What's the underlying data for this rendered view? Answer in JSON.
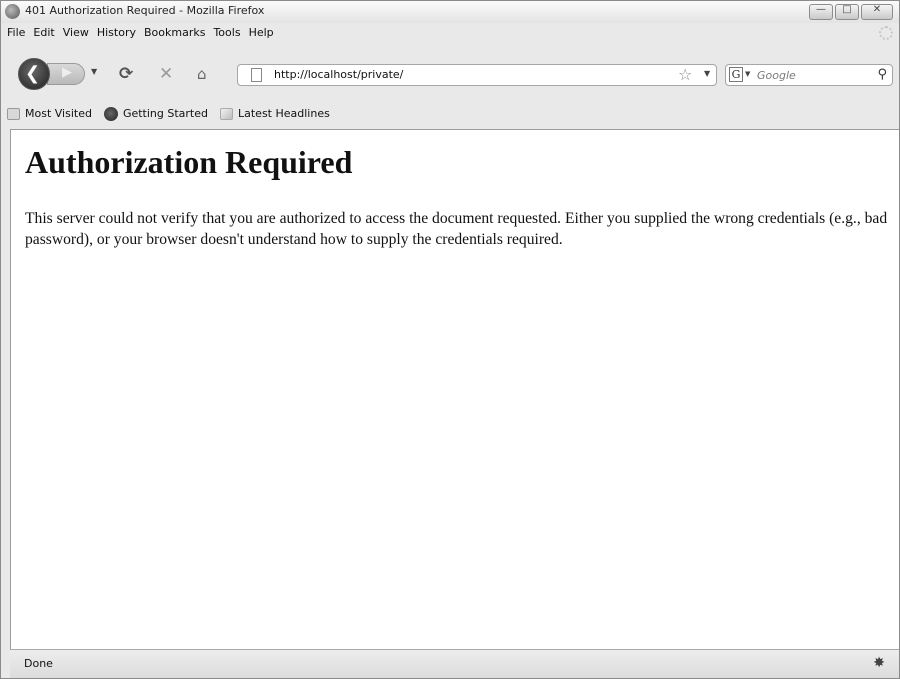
{
  "window": {
    "title": "401 Authorization Required - Mozilla Firefox"
  },
  "window_buttons": {
    "minimize": "—",
    "maximize": "□",
    "close": "✕"
  },
  "menu": [
    "File",
    "Edit",
    "View",
    "History",
    "Bookmarks",
    "Tools",
    "Help"
  ],
  "nav": {
    "url": "http://localhost/private/",
    "search_placeholder": "Google",
    "search_engine_letter": "G",
    "icons": {
      "back": "back-arrow-icon",
      "forward": "forward-arrow-icon",
      "reload": "reload-icon",
      "stop": "stop-icon",
      "home": "home-icon",
      "bookmark_star": "star-icon",
      "search": "magnifier-icon"
    }
  },
  "bookmarks": [
    "Most Visited",
    "Getting Started",
    "Latest Headlines"
  ],
  "page": {
    "heading": "Authorization Required",
    "body": "This server could not verify that you are authorized to access the document requested. Either you supplied the wrong credentials (e.g., bad password), or your browser doesn't understand how to supply the credentials required."
  },
  "status": {
    "text": "Done"
  }
}
